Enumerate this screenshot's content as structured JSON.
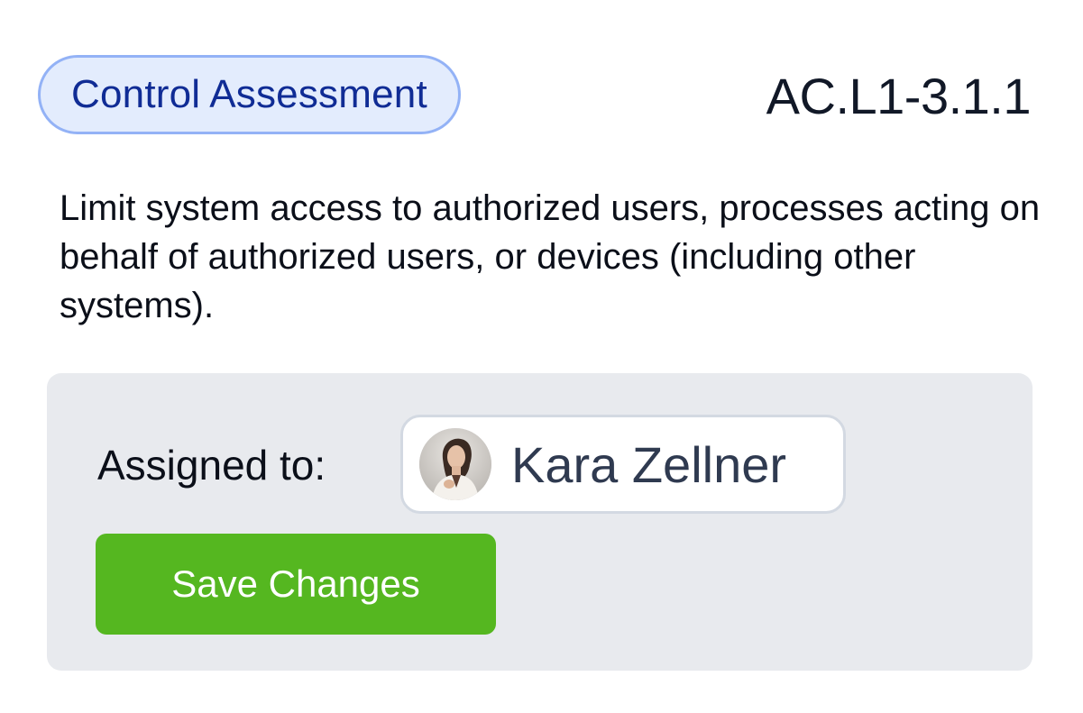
{
  "header": {
    "badge_label": "Control Assessment",
    "control_id": "AC.L1-3.1.1"
  },
  "description": "Limit system access to authorized users, processes acting on behalf of authorized users, or devices (including other systems).",
  "assignment": {
    "label": "Assigned to:",
    "assignee_name": "Kara Zellner",
    "avatar_icon": "user-avatar-photo"
  },
  "actions": {
    "save_label": "Save Changes"
  },
  "colors": {
    "badge_bg": "#e3ecfd",
    "badge_border": "#93b2f6",
    "badge_text": "#102c95",
    "panel_bg": "#e8eaee",
    "save_button": "#55b720"
  }
}
